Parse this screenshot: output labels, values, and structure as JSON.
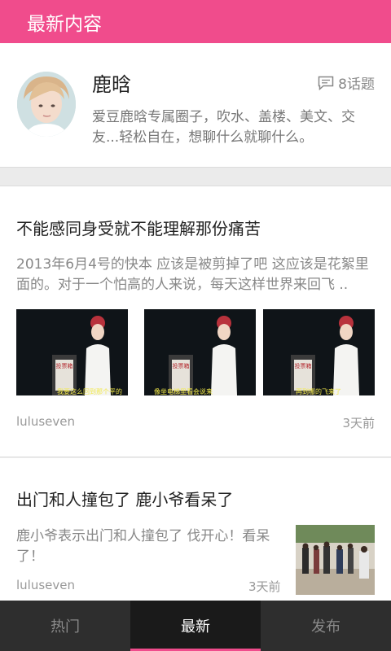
{
  "header": {
    "title": "最新内容"
  },
  "circle": {
    "name": "鹿晗",
    "topic_count": "8话题",
    "description": "爱豆鹿晗专属圈子，吹水、盖楼、美文、交友...轻松自在，想聊什么就聊什么。",
    "avatar_icon": "avatar-photo"
  },
  "posts": [
    {
      "title": "不能感同身受就不能理解那份痛苦",
      "excerpt": "2013年6月4号的快本 应该是被剪掉了吧 这应该是花絮里面的。对于一个怕高的人来说，每天这样世界来回飞 ..",
      "author": "luluseven",
      "time": "3天前",
      "thumbs": [
        {
          "sign": "投票箱",
          "caption": "我要这么回到那个平的"
        },
        {
          "sign": "投票箱",
          "caption": "像坐电梯里看会说来"
        },
        {
          "sign": "投票箱",
          "caption": "再到哪的飞来了"
        }
      ]
    },
    {
      "title": "出门和人撞包了 鹿小爷看呆了",
      "excerpt": "鹿小爷表示出门和人撞包了 伐开心！看呆了！",
      "author": "luluseven",
      "time": "3天前"
    }
  ],
  "tabs": [
    {
      "label": "热门",
      "active": false
    },
    {
      "label": "最新",
      "active": true
    },
    {
      "label": "发布",
      "active": false
    }
  ],
  "colors": {
    "accent": "#f04c8c",
    "tabbar": "#2e2e2e"
  }
}
